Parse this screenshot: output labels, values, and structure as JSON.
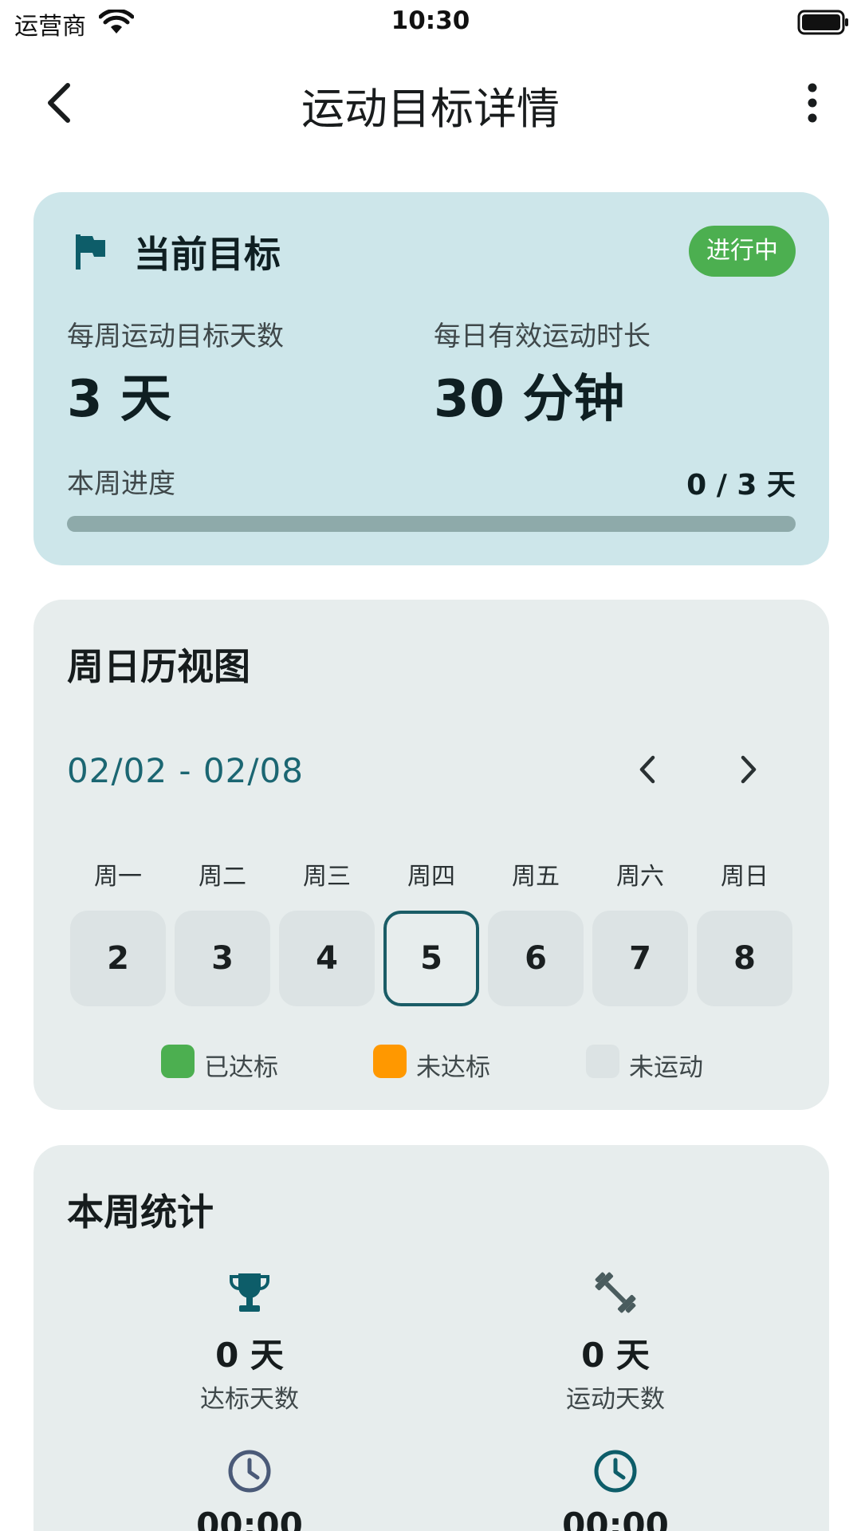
{
  "status_bar": {
    "carrier": "运营商",
    "time": "10:30"
  },
  "header": {
    "title": "运动目标详情"
  },
  "goal": {
    "title": "当前目标",
    "status": "进行中",
    "weekly_days_label": "每周运动目标天数",
    "weekly_days_value": "3 天",
    "daily_duration_label": "每日有效运动时长",
    "daily_duration_value": "30 分钟",
    "progress_label": "本周进度",
    "progress_value": "0 / 3 天",
    "progress_fraction": 0
  },
  "calendar": {
    "title": "周日历视图",
    "range": "02/02 - 02/08",
    "weekdays": [
      "周一",
      "周二",
      "周三",
      "周四",
      "周五",
      "周六",
      "周日"
    ],
    "days": [
      "2",
      "3",
      "4",
      "5",
      "6",
      "7",
      "8"
    ],
    "today_index": 3,
    "legend": [
      {
        "label": "已达标",
        "color": "#4caf50"
      },
      {
        "label": "未达标",
        "color": "#ff9800"
      },
      {
        "label": "未运动",
        "color": "#dce3e4"
      }
    ]
  },
  "stats": {
    "title": "本周统计",
    "items": [
      {
        "value": "0 天",
        "label": "达标天数",
        "icon": "trophy-icon"
      },
      {
        "value": "0 天",
        "label": "运动天数",
        "icon": "dumbbell-icon"
      },
      {
        "value": "00:00",
        "label": "",
        "icon": "clock-icon"
      },
      {
        "value": "00:00",
        "label": "",
        "icon": "clock-icon"
      }
    ]
  },
  "colors": {
    "primary": "#006874",
    "goal_card_bg": "#cde6ea",
    "card_bg": "#e7eded",
    "badge_green": "#4caf50"
  }
}
